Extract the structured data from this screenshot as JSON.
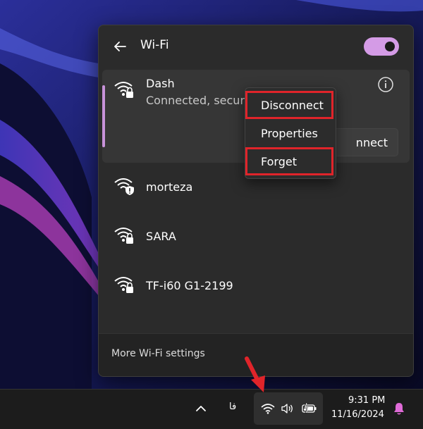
{
  "wifi_panel": {
    "title": "Wi-Fi",
    "toggle_on": true,
    "active_network": {
      "name": "Dash",
      "status": "Connected, secur",
      "connect_button_visible_text": "nnect"
    },
    "networks": [
      {
        "name": "morteza",
        "icon": "wifi-shield-warning-icon"
      },
      {
        "name": "SARA",
        "icon": "wifi-lock-icon"
      },
      {
        "name": "TF-i60 G1-2199",
        "icon": "wifi-lock-icon"
      }
    ],
    "footer_link": "More Wi-Fi settings"
  },
  "context_menu": {
    "items": [
      "Disconnect",
      "Properties",
      "Forget"
    ],
    "highlighted": [
      "Disconnect",
      "Forget"
    ]
  },
  "taskbar": {
    "language": "فا",
    "time": "9:31 PM",
    "date": "11/16/2024"
  },
  "colors": {
    "accent": "#d49be6",
    "highlight_red": "#e0242a",
    "panel_bg": "#2b2b2b"
  }
}
